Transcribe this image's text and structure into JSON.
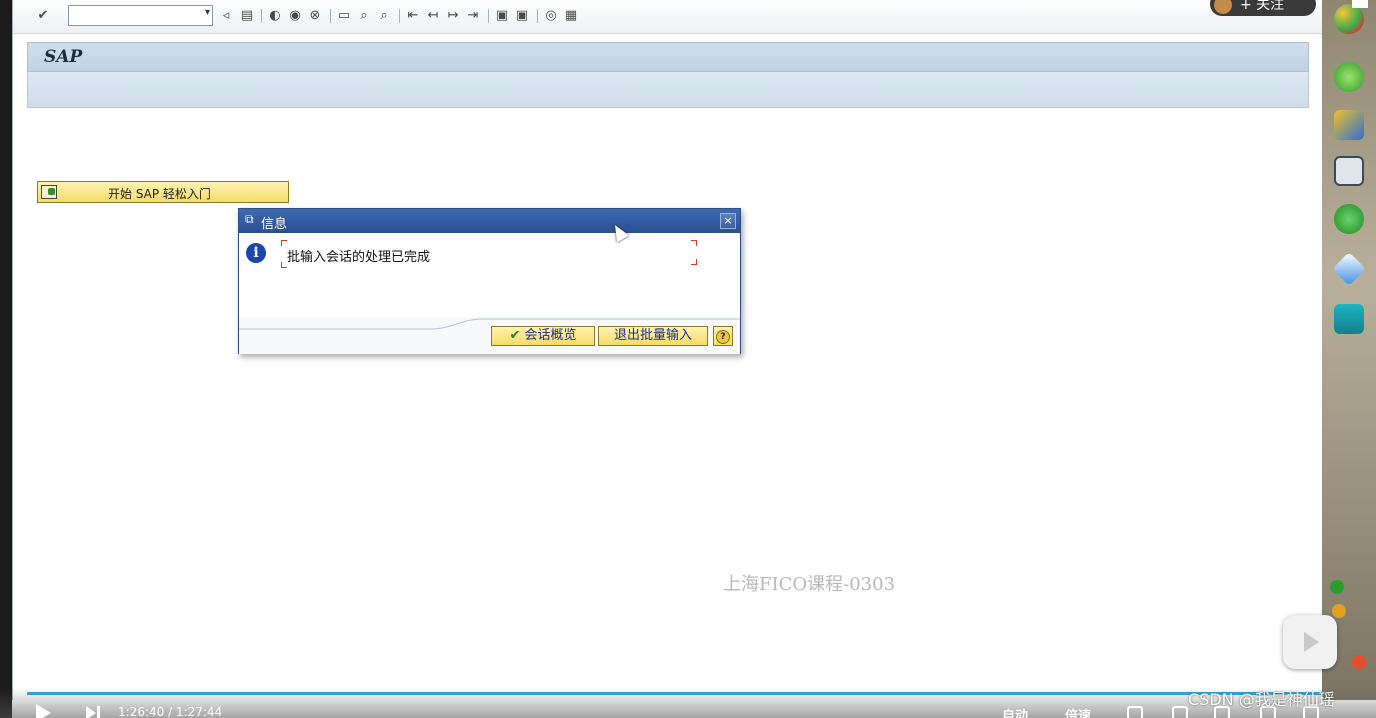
{
  "toolbar": {
    "command_field_value": "",
    "icons": [
      "enter-icon",
      "back-icon",
      "save-icon",
      "back-nav-icon",
      "exit-icon",
      "cancel-icon",
      "print-icon",
      "find-icon",
      "find-next-icon",
      "first-page-icon",
      "prev-page-icon",
      "next-page-icon",
      "last-page-icon",
      "new-session-icon",
      "shortcut-icon",
      "help-icon",
      "layout-icon"
    ]
  },
  "title_bar": {
    "title": "SAP"
  },
  "main": {
    "start_button_label": "开始 SAP 轻松入门"
  },
  "dialog": {
    "title": "信息",
    "message": "批输入会话的处理已完成",
    "buttons": {
      "overview": "会话概览",
      "exit": "退出批量输入",
      "help_glyph": "?"
    }
  },
  "watermark": "上海FICO课程-0303",
  "overlay": {
    "follow_label": "+ 关注",
    "csdn_label": "CSDN @我是神仙瑶"
  },
  "player": {
    "time": "1:26:40 / 1:27:44",
    "auto_label": "自动",
    "speed_label": "倍速"
  },
  "colors": {
    "title_bar_bg": "#c7d9e8",
    "dialog_title_bg": "#2f5597",
    "button_bg": "#f7dc6a",
    "progress": "#2ea1d6"
  }
}
